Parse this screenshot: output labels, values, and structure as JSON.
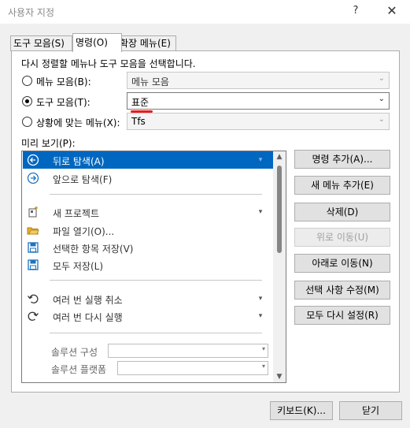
{
  "window": {
    "title": "사용자 지정",
    "help_glyph": "?",
    "close_glyph": "✕"
  },
  "tabs": [
    {
      "label": "도구 모음(S)"
    },
    {
      "label": "명령(O)"
    },
    {
      "label": "확장 메뉴(E)"
    }
  ],
  "instruction": "다시 정렬할 메뉴나 도구 모음을 선택합니다.",
  "rearrange": [
    {
      "label": "메뉴 모음(B):",
      "selected": false,
      "value": "메뉴 모음",
      "enabled": false
    },
    {
      "label": "도구 모음(T):",
      "selected": true,
      "value": "표준",
      "enabled": true
    },
    {
      "label": "상황에 맞는 메뉴(X):",
      "selected": false,
      "value": "Tfs",
      "enabled": false
    }
  ],
  "preview": {
    "label": "미리 보기(P):",
    "items": [
      {
        "label": "뒤로 탐색(A)",
        "icon": "back-icon",
        "selected": true
      },
      {
        "label": "앞으로 탐색(F)",
        "icon": "forward-icon",
        "selected": false
      },
      {
        "label": "새 프로젝트",
        "icon": "new-project-icon",
        "selected": false
      },
      {
        "label": "파일 열기(O)...",
        "icon": "open-folder-icon",
        "selected": false
      },
      {
        "label": "선택한 항목 저장(V)",
        "icon": "save-icon",
        "selected": false
      },
      {
        "label": "모두 저장(L)",
        "icon": "save-all-icon",
        "selected": false
      },
      {
        "label": "여러 번 실행 취소",
        "icon": "undo-icon",
        "selected": false
      },
      {
        "label": "여러 번 다시 실행",
        "icon": "redo-icon",
        "selected": false
      },
      {
        "label": "솔루션 구성",
        "icon": "",
        "selected": false
      },
      {
        "label": "솔루션 플랫폼",
        "icon": "",
        "selected": false
      }
    ]
  },
  "buttons": {
    "add_command": "명령 추가(A)...",
    "add_menu": "새 메뉴 추가(E)",
    "delete": "삭제(D)",
    "move_up": "위로 이동(U)",
    "move_down": "아래로 이동(N)",
    "modify_selection": "선택 사항 수정(M)",
    "reset_all": "모두 다시 설정(R)",
    "keyboard": "키보드(K)...",
    "close": "닫기"
  },
  "colors": {
    "selection": "#0067c0",
    "annotation_red": "#e81c1c"
  }
}
